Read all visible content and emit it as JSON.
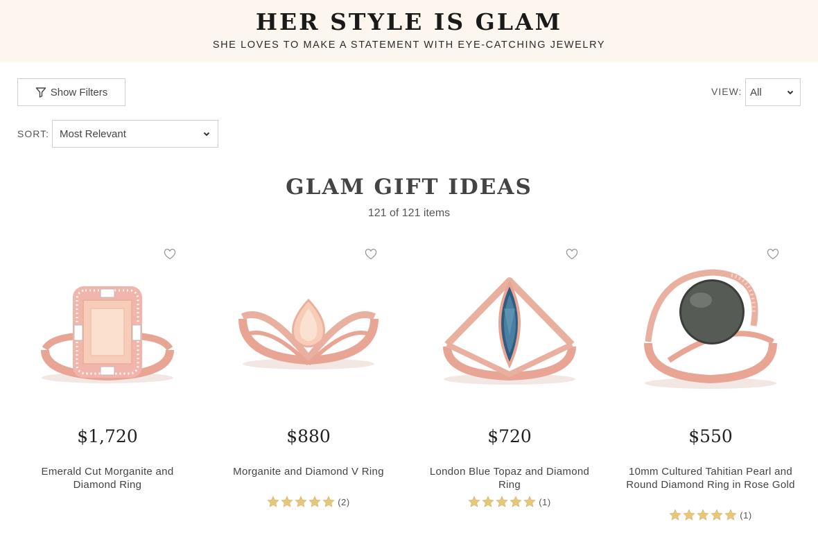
{
  "hero": {
    "title": "HER STYLE IS GLAM",
    "subtitle": "SHE LOVES TO MAKE A STATEMENT WITH EYE-CATCHING JEWELRY"
  },
  "controls": {
    "filter_label": "Show Filters",
    "view_label": "VIEW:",
    "view_value": "All",
    "sort_label": "SORT:",
    "sort_value": "Most Relevant"
  },
  "section": {
    "title": "GLAM GIFT IDEAS",
    "count": "121 of 121 items"
  },
  "colors": {
    "hero_bg": "#fdf6ee",
    "rose_gold": "#e8a593",
    "star": "#e8c77a"
  },
  "products": [
    {
      "price": "$1,720",
      "name": "Emerald Cut Morganite and Diamond Ring",
      "stars": 0,
      "rating_count": "",
      "gem": "morganite-emerald"
    },
    {
      "price": "$880",
      "name": "Morganite and Diamond V Ring",
      "stars": 5,
      "rating_count": "(2)",
      "gem": "morganite-pear"
    },
    {
      "price": "$720",
      "name": "London Blue Topaz and Diamond Ring",
      "stars": 5,
      "rating_count": "(1)",
      "gem": "topaz-marquise"
    },
    {
      "price": "$550",
      "name": "10mm Cultured Tahitian Pearl and Round Diamond Ring in Rose Gold",
      "stars": 5,
      "rating_count": "(1)",
      "gem": "tahitian-pearl"
    }
  ]
}
